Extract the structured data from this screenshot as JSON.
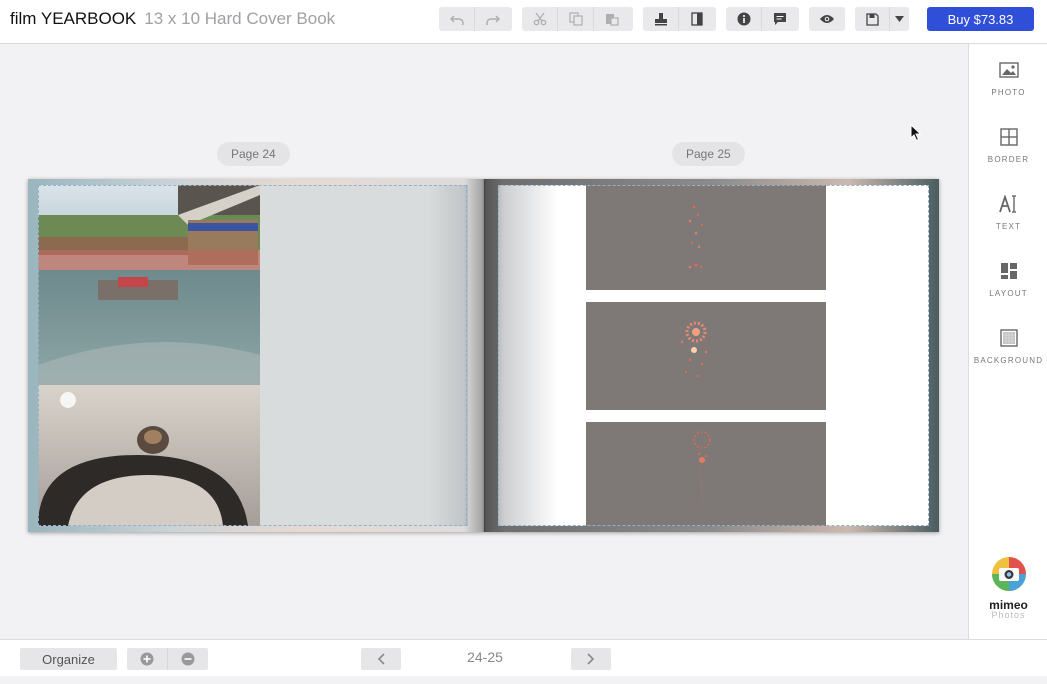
{
  "header": {
    "title": "film YEARBOOK",
    "subtitle": "13 x 10 Hard Cover Book",
    "buy_label": "Buy $73.83"
  },
  "toolbar": {
    "undo": "undo-icon",
    "redo": "redo-icon",
    "cut": "scissors-icon",
    "copy": "copy-icon",
    "paste": "paste-icon",
    "stamp": "stamp-icon",
    "spine": "book-spine-icon",
    "info": "info-icon",
    "comment": "comment-icon",
    "preview": "eye-icon",
    "save": "save-icon",
    "dropdown": "caret-down-icon"
  },
  "sidebar": {
    "items": [
      {
        "label": "PHOTO",
        "icon": "photo-icon"
      },
      {
        "label": "BORDER",
        "icon": "border-icon"
      },
      {
        "label": "TEXT",
        "icon": "text-icon"
      },
      {
        "label": "LAYOUT",
        "icon": "layout-icon"
      },
      {
        "label": "BACKGROUND",
        "icon": "background-icon"
      }
    ],
    "brand": "mimeo",
    "brand_sub": "Photos"
  },
  "spread": {
    "left_page_label": "Page 24",
    "right_page_label": "Page 25"
  },
  "footer": {
    "organize_label": "Organize",
    "page_range": "24-25"
  },
  "colors": {
    "accent": "#2f4fd9",
    "guide": "#8fb2cf"
  }
}
